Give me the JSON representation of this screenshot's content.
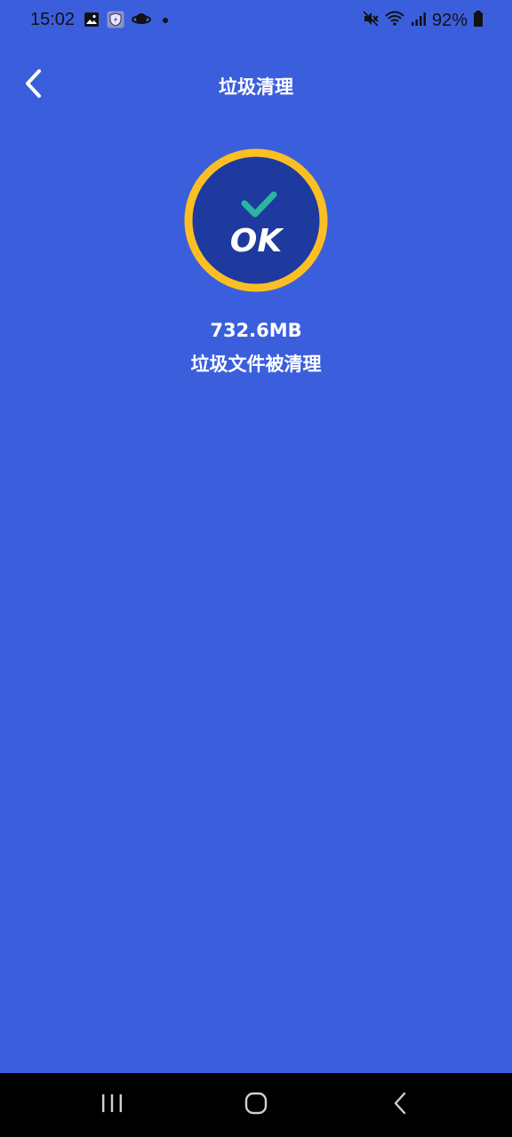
{
  "status_bar": {
    "time": "15:02",
    "battery": "92%",
    "left_icons": [
      "image-icon",
      "shield-icon",
      "planet-icon",
      "dot-icon"
    ],
    "right_icons": [
      "mute-icon",
      "wifi-icon",
      "signal-icon",
      "battery-icon"
    ]
  },
  "app_bar": {
    "title": "垃圾清理"
  },
  "result": {
    "badge_text": "OK",
    "amount": "732.6MB",
    "message": "垃圾文件被清理"
  },
  "colors": {
    "background": "#3b5fdc",
    "badge_ring": "#fbbf24",
    "badge_fill": "#1e3a9e",
    "check": "#2bb5a3"
  },
  "nav_bar": {
    "buttons": [
      "recent-apps-icon",
      "home-icon",
      "back-icon"
    ]
  }
}
